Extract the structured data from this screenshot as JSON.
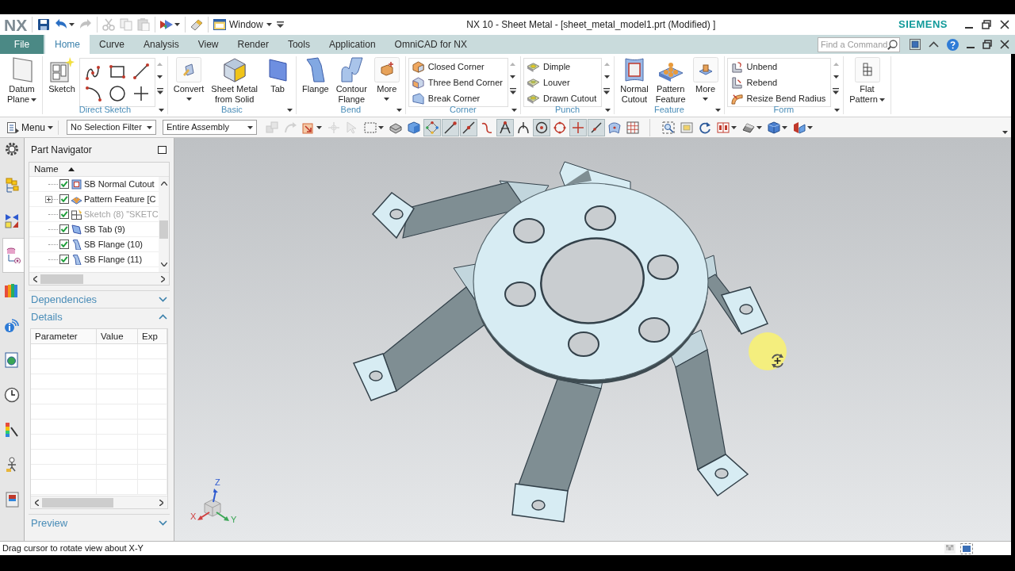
{
  "title_bar": {
    "logo": "NX",
    "window_menu": "Window",
    "title": "NX 10 - Sheet Metal - [sheet_metal_model1.prt (Modified) ]",
    "brand": "SIEMENS"
  },
  "quick_access": [
    [
      {
        "kind": "save",
        "disabled": false,
        "dropdown": false
      },
      {
        "kind": "undo",
        "disabled": false,
        "dropdown": true
      },
      {
        "kind": "redo",
        "disabled": true,
        "dropdown": false
      }
    ],
    [
      {
        "kind": "cut",
        "disabled": true,
        "dropdown": false
      },
      {
        "kind": "copy",
        "disabled": true,
        "dropdown": false
      },
      {
        "kind": "paste",
        "disabled": true,
        "dropdown": false
      }
    ],
    [
      {
        "kind": "repeat",
        "disabled": false,
        "dropdown": true
      }
    ],
    [
      {
        "kind": "touch",
        "disabled": false,
        "dropdown": false
      }
    ]
  ],
  "ribbon_tabs": [
    {
      "label": "File",
      "kind": "file",
      "selected": false
    },
    {
      "label": "Home",
      "kind": "tab",
      "selected": true
    },
    {
      "label": "Curve",
      "kind": "tab",
      "selected": false
    },
    {
      "label": "Analysis",
      "kind": "tab",
      "selected": false
    },
    {
      "label": "View",
      "kind": "tab",
      "selected": false
    },
    {
      "label": "Render",
      "kind": "tab",
      "selected": false
    },
    {
      "label": "Tools",
      "kind": "tab",
      "selected": false
    },
    {
      "label": "Application",
      "kind": "tab",
      "selected": false
    },
    {
      "label": "OmniCAD for NX",
      "kind": "tab",
      "selected": false
    }
  ],
  "command_search": {
    "placeholder": "Find a Command"
  },
  "ribbon_groups": [
    {
      "kind": "buttons",
      "menu": false,
      "commands": [
        {
          "kind": "large",
          "label": "Datum\nPlane",
          "dropdown": true
        }
      ]
    },
    {
      "kind": "buttons",
      "label": "Direct Sketch",
      "menu": true,
      "commands": [
        {
          "kind": "large",
          "label": "Sketch",
          "dropdown": false
        },
        {
          "kind": "gallery"
        }
      ]
    },
    {
      "kind": "buttons",
      "label": "Basic",
      "menu": true,
      "commands": [
        {
          "kind": "large",
          "label": "Convert",
          "dropdown": true
        },
        {
          "kind": "large",
          "label": "Sheet Metal\nfrom Solid",
          "dropdown": false
        },
        {
          "kind": "large",
          "label": "Tab",
          "dropdown": false
        }
      ]
    },
    {
      "kind": "buttons",
      "label": "Bend",
      "menu": true,
      "commands": [
        {
          "kind": "large",
          "label": "Flange",
          "dropdown": false
        },
        {
          "kind": "large",
          "label": "Contour\nFlange",
          "dropdown": false
        },
        {
          "kind": "large",
          "label": "More",
          "dropdown": true
        }
      ]
    },
    {
      "kind": "list",
      "label": "Corner",
      "menu": true,
      "commands": [
        {
          "label": "Closed Corner"
        },
        {
          "label": "Three Bend Corner"
        },
        {
          "label": "Break Corner"
        }
      ]
    },
    {
      "kind": "list",
      "label": "Punch",
      "menu": true,
      "commands": [
        {
          "label": "Dimple"
        },
        {
          "label": "Louver"
        },
        {
          "label": "Drawn Cutout"
        }
      ]
    },
    {
      "kind": "buttons",
      "label": "Feature",
      "menu": true,
      "commands": [
        {
          "kind": "large",
          "label": "Normal\nCutout",
          "dropdown": false
        },
        {
          "kind": "large",
          "label": "Pattern\nFeature",
          "dropdown": false
        },
        {
          "kind": "large",
          "label": "More",
          "dropdown": true
        }
      ]
    },
    {
      "kind": "list",
      "label": "Form",
      "menu": true,
      "commands": [
        {
          "label": "Unbend"
        },
        {
          "label": "Rebend"
        },
        {
          "label": "Resize Bend Radius"
        }
      ]
    },
    {
      "kind": "buttons",
      "menu": false,
      "commands": [
        {
          "kind": "large",
          "label": "Flat\nPattern",
          "dropdown": true
        }
      ]
    }
  ],
  "toolbar": {
    "menu": "Menu",
    "selection_filter": "No Selection Filter",
    "scope": "Entire Assembly",
    "tools": [
      [
        {
          "kind": "assembly",
          "selected": false,
          "disabled": true,
          "dropdown": false
        },
        {
          "kind": "constraint",
          "selected": false,
          "disabled": true,
          "dropdown": false
        },
        {
          "kind": "color-select",
          "selected": false,
          "disabled": false,
          "dropdown": true
        },
        {
          "kind": "snap-move",
          "selected": false,
          "disabled": true,
          "dropdown": false
        },
        {
          "kind": "pointer",
          "selected": false,
          "disabled": true,
          "dropdown": false
        },
        {
          "kind": "region",
          "selected": false,
          "disabled": false,
          "dropdown": true
        },
        {
          "kind": "shade",
          "selected": false,
          "disabled": false,
          "dropdown": false
        },
        {
          "kind": "body",
          "selected": false,
          "disabled": false,
          "dropdown": false
        },
        {
          "kind": "snap-grid",
          "selected": true,
          "disabled": false,
          "dropdown": false
        },
        {
          "kind": "end-point",
          "selected": true,
          "disabled": false,
          "dropdown": false
        },
        {
          "kind": "mid-point",
          "selected": true,
          "disabled": false,
          "dropdown": false
        },
        {
          "kind": "control-point",
          "selected": false,
          "disabled": false,
          "dropdown": false
        },
        {
          "kind": "intersection",
          "selected": true,
          "disabled": false,
          "dropdown": false
        },
        {
          "kind": "arc-center",
          "selected": false,
          "disabled": false,
          "dropdown": false
        },
        {
          "kind": "center",
          "selected": true,
          "disabled": false,
          "dropdown": false
        },
        {
          "kind": "quadrant",
          "selected": false,
          "disabled": false,
          "dropdown": false
        },
        {
          "kind": "existing-point",
          "selected": true,
          "disabled": false,
          "dropdown": false
        },
        {
          "kind": "point-on-curve",
          "selected": true,
          "disabled": false,
          "dropdown": false
        },
        {
          "kind": "point-on-face",
          "selected": false,
          "disabled": false,
          "dropdown": false
        },
        {
          "kind": "bounded-grid",
          "selected": false,
          "disabled": false,
          "dropdown": false
        }
      ],
      [
        {
          "kind": "fit",
          "selected": false,
          "disabled": false,
          "dropdown": false
        },
        {
          "kind": "zoom",
          "selected": false,
          "disabled": false,
          "dropdown": false
        },
        {
          "kind": "rotate",
          "selected": false,
          "disabled": false,
          "dropdown": false
        },
        {
          "kind": "layout",
          "selected": false,
          "disabled": false,
          "dropdown": true
        },
        {
          "kind": "render",
          "selected": false,
          "disabled": false,
          "dropdown": true
        },
        {
          "kind": "display",
          "selected": false,
          "disabled": false,
          "dropdown": true
        },
        {
          "kind": "section",
          "selected": false,
          "disabled": false,
          "dropdown": true
        }
      ]
    ]
  },
  "resource_bar": [
    {
      "kind": "options",
      "selected": false
    },
    {
      "kind": "assembly-navigator",
      "selected": false
    },
    {
      "kind": "constraint-navigator",
      "selected": false
    },
    {
      "kind": "part-navigator",
      "selected": true
    },
    {
      "kind": "reuse-library",
      "selected": false
    },
    {
      "kind": "hd3d",
      "selected": false
    },
    {
      "kind": "web-browser",
      "selected": false
    },
    {
      "kind": "history",
      "selected": false
    },
    {
      "kind": "visualization",
      "selected": false
    },
    {
      "kind": "roles",
      "selected": false
    },
    {
      "kind": "scenes",
      "selected": false
    }
  ],
  "navigator": {
    "title": "Part Navigator",
    "column": "Name",
    "rows": [
      {
        "label": "SB Normal Cutout",
        "kind": "cutout",
        "checked": true,
        "expandable": false,
        "disabled": false
      },
      {
        "label": "Pattern Feature [C",
        "kind": "pattern",
        "checked": true,
        "expandable": true,
        "disabled": false
      },
      {
        "label": "Sketch (8) \"SKETC",
        "kind": "sketch",
        "checked": true,
        "expandable": false,
        "disabled": true
      },
      {
        "label": "SB Tab (9)",
        "kind": "tab",
        "checked": true,
        "expandable": false,
        "disabled": false
      },
      {
        "label": "SB Flange (10)",
        "kind": "flange",
        "checked": true,
        "expandable": false,
        "disabled": false
      },
      {
        "label": "SB Flange (11)",
        "kind": "flange",
        "checked": true,
        "expandable": false,
        "disabled": false
      }
    ]
  },
  "panel_sections": [
    {
      "title": "Dependencies",
      "expanded": false
    },
    {
      "title": "Details",
      "expanded": true,
      "columns": [
        "Parameter",
        "Value",
        "Exp"
      ]
    },
    {
      "title": "Preview",
      "expanded": false
    }
  ],
  "triad": {
    "x": "X",
    "y": "Y",
    "z": "Z"
  },
  "status_bar": {
    "message": "Drag cursor to rotate view about X-Y"
  }
}
